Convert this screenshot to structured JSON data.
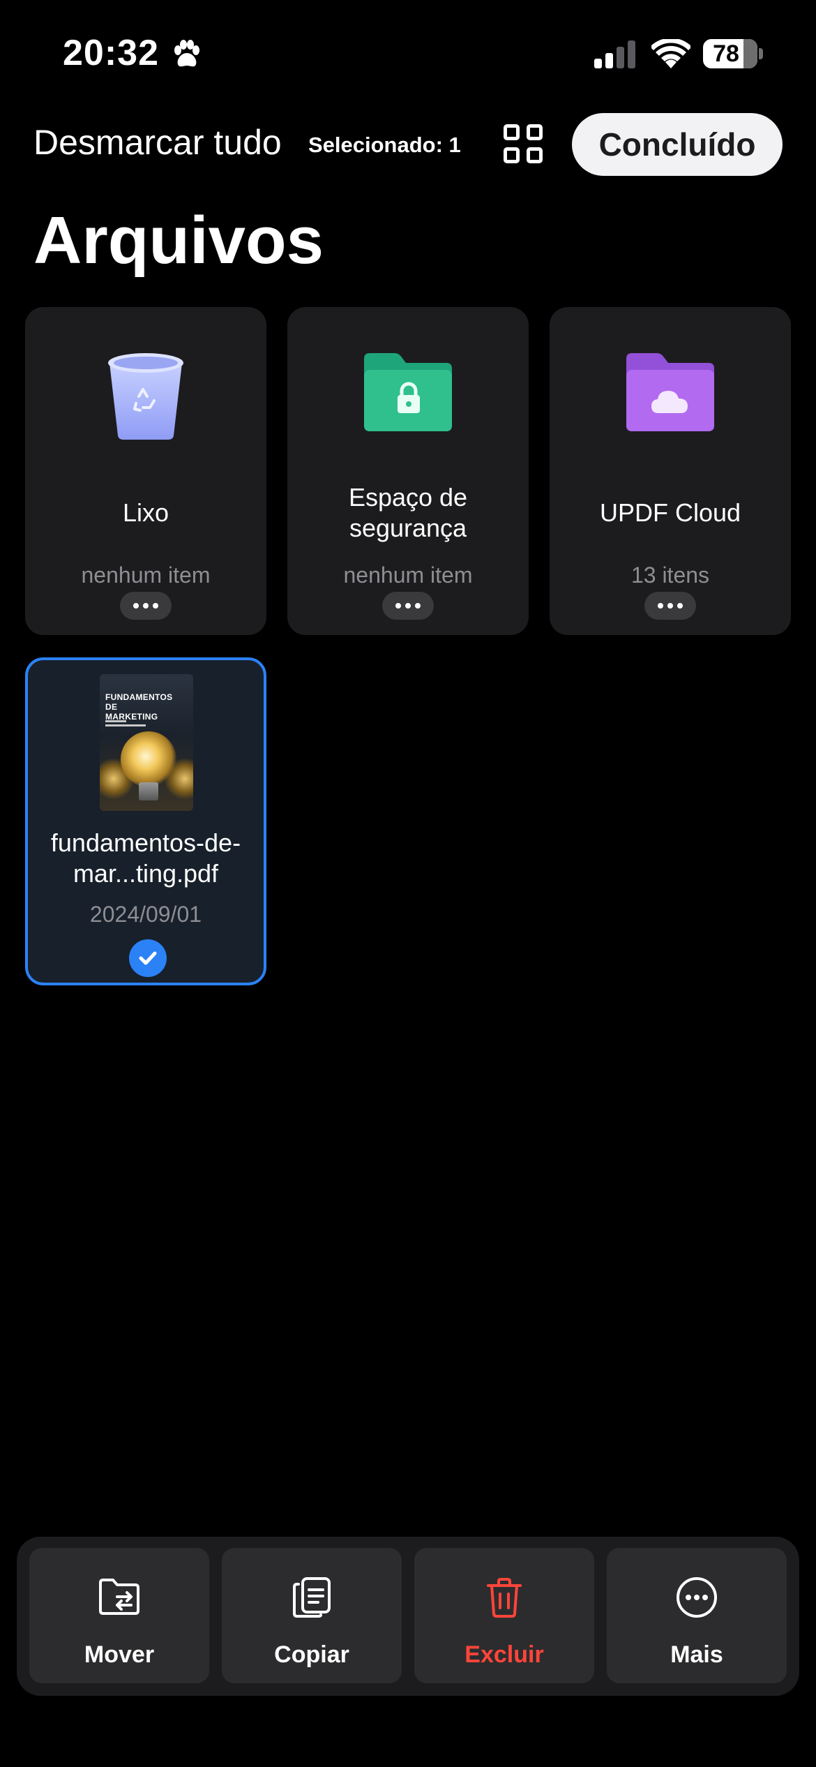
{
  "status_bar": {
    "time": "20:32",
    "battery": "78",
    "icons": [
      "paw-icon",
      "signal-icon",
      "wifi-icon",
      "battery-icon"
    ]
  },
  "toolbar": {
    "deselect_all": "Desmarcar tudo",
    "selected_count": "Selecionado: 1",
    "view_toggle_icon": "grid-view-icon",
    "done": "Concluído"
  },
  "title": "Arquivos",
  "folders": [
    {
      "name": "Lixo",
      "count": "nenhum item",
      "icon": "trash-bin-icon"
    },
    {
      "name": "Espaço de segurança",
      "count": "nenhum item",
      "icon": "secure-folder-icon"
    },
    {
      "name": "UPDF Cloud",
      "count": "13 itens",
      "icon": "cloud-folder-icon"
    }
  ],
  "file": {
    "name": "fundamentos-de-mar...ting.pdf",
    "date": "2024/09/01",
    "selected": true,
    "thumbnail_title": "FUNDAMENTOS DE MARKETING"
  },
  "actions": [
    {
      "label": "Mover",
      "icon": "move-folder-icon"
    },
    {
      "label": "Copiar",
      "icon": "copy-icon"
    },
    {
      "label": "Excluir",
      "icon": "trash-icon",
      "color": "#ff453a"
    },
    {
      "label": "Mais",
      "icon": "more-circle-icon"
    }
  ],
  "colors": {
    "accent": "#2b82f6",
    "danger": "#ff453a",
    "secure_folder": "#2fc08e",
    "cloud_folder": "#b26af0",
    "trash": "#a8b4ff"
  }
}
